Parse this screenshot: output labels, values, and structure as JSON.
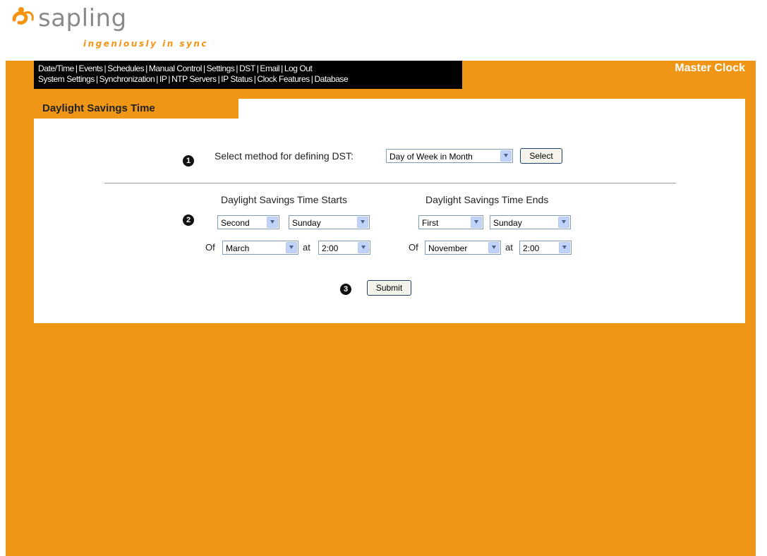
{
  "brand": {
    "logo_text": "sapling",
    "tagline": "ingeniously in sync",
    "product_title": "Master Clock",
    "accent_color": "#f09617"
  },
  "nav": {
    "row1": [
      "Date/Time",
      "Events",
      "Schedules",
      "Manual Control",
      "Settings",
      "DST",
      "Email",
      "Log Out"
    ],
    "row2": [
      "System Settings",
      "Synchronization",
      "IP",
      "NTP Servers",
      "IP Status",
      "Clock Features",
      "Database"
    ]
  },
  "page": {
    "title": "Daylight Savings Time"
  },
  "steps": [
    "1",
    "2",
    "3"
  ],
  "method": {
    "label": "Select method for defining DST:",
    "selected": "Day of Week in Month",
    "button": "Select"
  },
  "starts": {
    "heading": "Daylight Savings Time Starts",
    "week": "Second",
    "day": "Sunday",
    "of_label": "Of",
    "month": "March",
    "at_label": "at",
    "time": "2:00"
  },
  "ends": {
    "heading": "Daylight Savings Time Ends",
    "week": "First",
    "day": "Sunday",
    "of_label": "Of",
    "month": "November",
    "at_label": "at",
    "time": "2:00"
  },
  "submit": {
    "label": "Submit"
  }
}
